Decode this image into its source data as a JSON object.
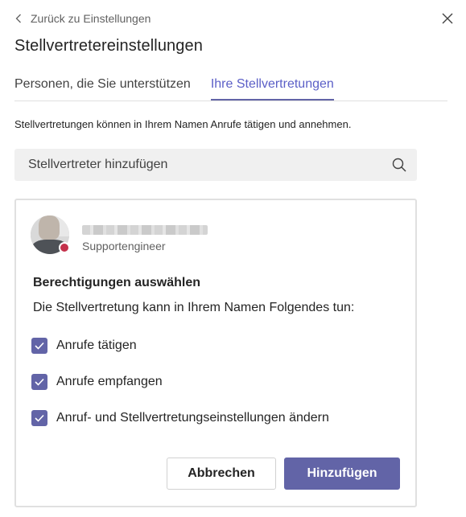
{
  "header": {
    "back_label": "Zurück zu Einstellungen",
    "title": "Stellvertretereinstellungen"
  },
  "tabs": [
    {
      "label": "Personen, die Sie unterstützen",
      "active": false
    },
    {
      "label": "Ihre Stellvertretungen",
      "active": true
    }
  ],
  "description": "Stellvertretungen können in Ihrem Namen Anrufe tätigen und annehmen.",
  "search": {
    "placeholder": "Stellvertreter hinzufügen"
  },
  "delegate": {
    "role": "Supportengineer",
    "presence_color": "#c4314b"
  },
  "permissions": {
    "heading": "Berechtigungen auswählen",
    "subheading": "Die Stellvertretung kann in Ihrem Namen Folgendes tun:",
    "items": [
      {
        "label": "Anrufe tätigen",
        "checked": true
      },
      {
        "label": "Anrufe empfangen",
        "checked": true
      },
      {
        "label": "Anruf- und Stellvertretungseinstellungen ändern",
        "checked": true
      }
    ]
  },
  "buttons": {
    "cancel_label": "Abbrechen",
    "add_label": "Hinzufügen"
  },
  "colors": {
    "accent": "#6264a7",
    "tab_active_text": "#5b5fc7"
  },
  "icons": {
    "back": "chevron-left-icon",
    "close": "close-icon",
    "search": "search-icon",
    "checkbox": "checkmark-icon"
  }
}
